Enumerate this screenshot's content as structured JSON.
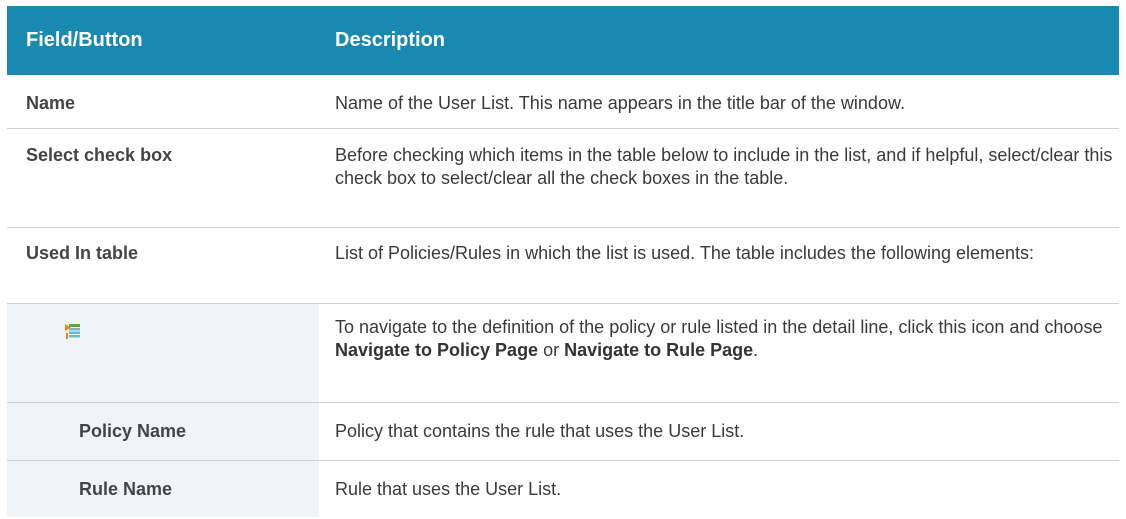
{
  "header": {
    "col1": "Field/Button",
    "col2": "Description"
  },
  "rows": [
    {
      "field": "Name",
      "desc": "Name of the User List. This name appears in the title bar of the window."
    },
    {
      "field": "Select check box",
      "desc": "Before checking which items in the table below to include in the list, and if helpful, select/clear this check box to select/clear all the check boxes in the table."
    },
    {
      "field": "Used In table",
      "desc": "List of Policies/Rules in which the list is used. The table includes the following elements:"
    },
    {
      "icon": "navigate-menu-icon",
      "desc_pre": "To navigate to the definition of the policy or rule listed in the detail line, click this icon and choose ",
      "desc_b1": "Navigate to Policy Page",
      "desc_mid": " or ",
      "desc_b2": "Navigate to Rule Page",
      "desc_post": "."
    },
    {
      "field": "Policy Name",
      "desc": "Policy that contains the rule that uses the User List."
    },
    {
      "field": "Rule Name",
      "desc": "Rule that uses the User List."
    }
  ],
  "colors": {
    "header_bg": "#1a89b2",
    "shade": "#f0f4f7",
    "icon_orange": "#e8861a",
    "icon_green": "#5aa832"
  }
}
